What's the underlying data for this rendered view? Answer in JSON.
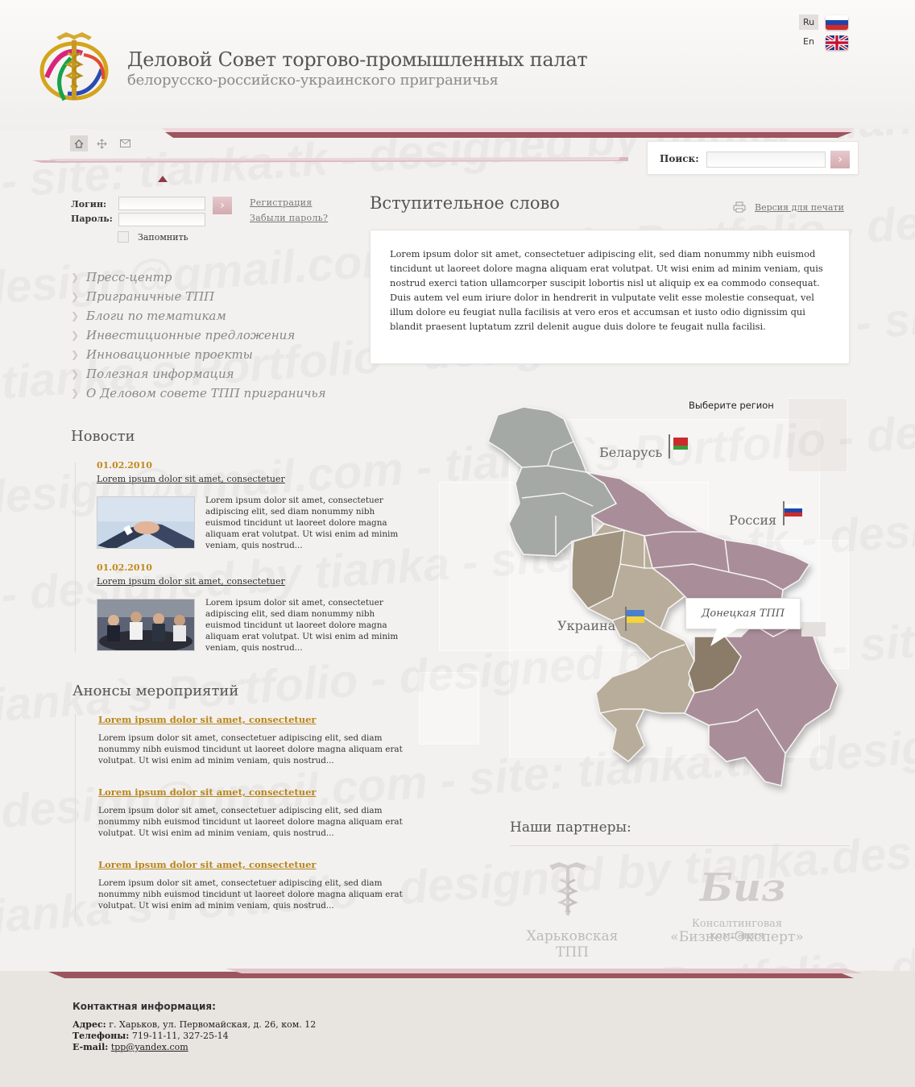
{
  "header": {
    "title": "Деловой Совет торгово-промышленных палат",
    "subtitle": "белорусско-российско-украинского приграничья",
    "languages": [
      {
        "code": "Ru",
        "active": true
      },
      {
        "code": "En",
        "active": false
      }
    ]
  },
  "topnav": {
    "icons": [
      "home-icon",
      "sitemap-icon",
      "mail-icon"
    ]
  },
  "search": {
    "label": "Поиск:",
    "value": "",
    "button": "›"
  },
  "login": {
    "login_label": "Логин:",
    "password_label": "Пароль:",
    "remember_label": "Запомнить",
    "register_link": "Регистрация",
    "forgot_link": "Забыли пароль?",
    "button": "›"
  },
  "menu": [
    "Пресс-центр",
    "Приграничные ТПП",
    "Блоги по тематикам",
    "Инвестиционные предложения",
    "Инновационные проекты",
    "Полезная информация",
    "О Деловом совете ТПП приграничья"
  ],
  "news": {
    "title": "Новости",
    "items": [
      {
        "date": "01.02.2010",
        "title": "Lorem ipsum dolor sit amet, consectetuer",
        "text": "Lorem ipsum dolor sit amet, consectetuer adipiscing elit, sed diam nonummy nibh euismod tincidunt ut laoreet dolore magna aliquam erat volutpat. Ut wisi enim ad minim veniam, quis nostrud..."
      },
      {
        "date": "01.02.2010",
        "title": "Lorem ipsum dolor sit amet, consectetuer",
        "text": "Lorem ipsum dolor sit amet, consectetuer adipiscing elit, sed diam nonummy nibh euismod tincidunt ut laoreet dolore magna aliquam erat volutpat. Ut wisi enim ad minim veniam, quis nostrud..."
      }
    ]
  },
  "events": {
    "title": "Анонсы мероприятий",
    "items": [
      {
        "title": "Lorem ipsum dolor sit amet, consectetuer",
        "text": "Lorem ipsum dolor sit amet, consectetuer adipiscing elit, sed diam nonummy nibh euismod tincidunt ut laoreet dolore magna aliquam erat volutpat. Ut wisi enim ad minim veniam, quis nostrud..."
      },
      {
        "title": "Lorem ipsum dolor sit amet, consectetuer",
        "text": "Lorem ipsum dolor sit amet, consectetuer adipiscing elit, sed diam nonummy nibh euismod tincidunt ut laoreet dolore magna aliquam erat volutpat. Ut wisi enim ad minim veniam, quis nostrud..."
      },
      {
        "title": "Lorem ipsum dolor sit amet, consectetuer",
        "text": "Lorem ipsum dolor sit amet, consectetuer adipiscing elit, sed diam nonummy nibh euismod tincidunt ut laoreet dolore magna aliquam erat volutpat. Ut wisi enim ad minim veniam, quis nostrud..."
      }
    ]
  },
  "intro": {
    "title": "Вступительное слово",
    "print_link": "Версия для печати",
    "text": "Lorem ipsum dolor sit amet, consectetuer adipiscing elit, sed diam nonummy nibh euismod tincidunt ut laoreet dolore magna aliquam erat volutpat. Ut wisi enim ad minim veniam, quis nostrud exerci tation ullamcorper suscipit lobortis nisl ut aliquip ex ea commodo consequat. Duis autem vel eum iriure dolor in hendrerit in vulputate velit esse molestie consequat, vel illum dolore eu feugiat nulla facilisis at vero eros et accumsan et iusto odio dignissim qui blandit praesent luptatum zzril delenit augue duis dolore te feugait nulla facilisi."
  },
  "map": {
    "caption": "Выберите  регион",
    "countries": [
      "Беларусь",
      "Россия",
      "Украина"
    ],
    "tooltip": "Донецкая ТПП",
    "colors": {
      "belarus": "#9ea3a0",
      "russia": "#a88d99",
      "ukraine": "#b9ae9c",
      "ukraine_dark": "#8c7c69"
    }
  },
  "partners": {
    "title": "Наши партнеры:",
    "items": [
      {
        "name": "Харьковская ТПП"
      },
      {
        "caption": "Консалтинговая компания",
        "name": "«Бизнес-Эксперт»",
        "logo_text": "Бизнес Эксперт"
      }
    ]
  },
  "footer": {
    "heading": "Контактная информация:",
    "address_label": "Адрес:",
    "address": "г. Харьков, ул. Первомайская, д. 26, ком. 12",
    "phones_label": "Телефоны:",
    "phones": "719-11-11, 327-25-14",
    "email_label": "E-mail:",
    "email": "tpp@yandex.com"
  },
  "accent_color": "#8e3b47"
}
